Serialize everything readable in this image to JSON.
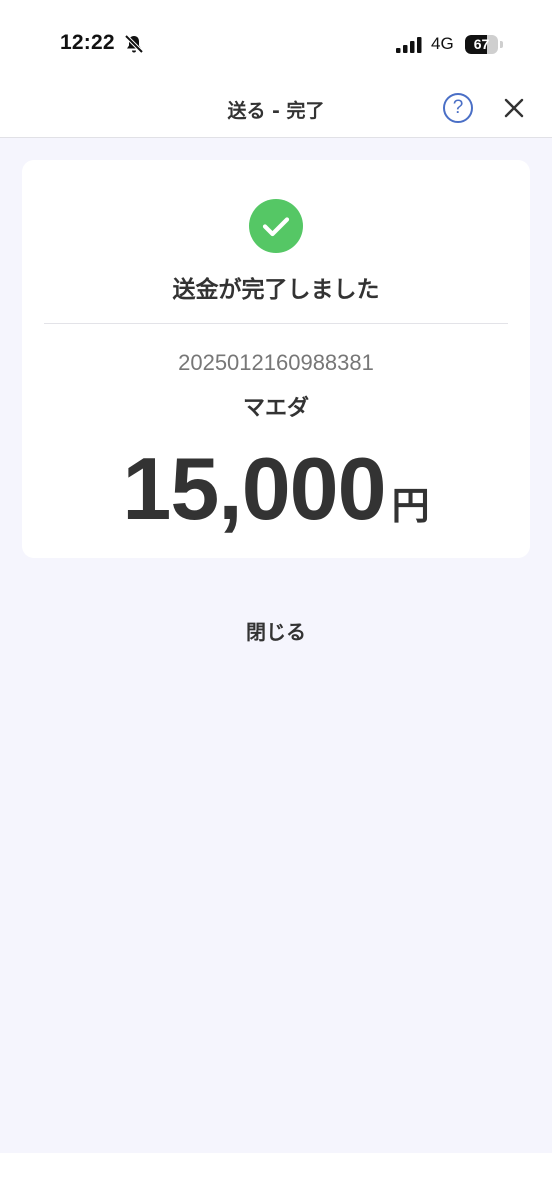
{
  "status_bar": {
    "time": "12:22",
    "network": "4G",
    "battery": "67",
    "battery_level": 0.67
  },
  "nav": {
    "title": "送る - 完了",
    "help_label": "?"
  },
  "result": {
    "title": "送金が完了しました",
    "transaction_id": "2025012160988381",
    "recipient": "マエダ",
    "amount": "15,000",
    "currency": "円"
  },
  "actions": {
    "close_label": "閉じる"
  },
  "colors": {
    "success": "#55c765",
    "accent": "#4a6fc6",
    "background": "#f5f5fd"
  }
}
